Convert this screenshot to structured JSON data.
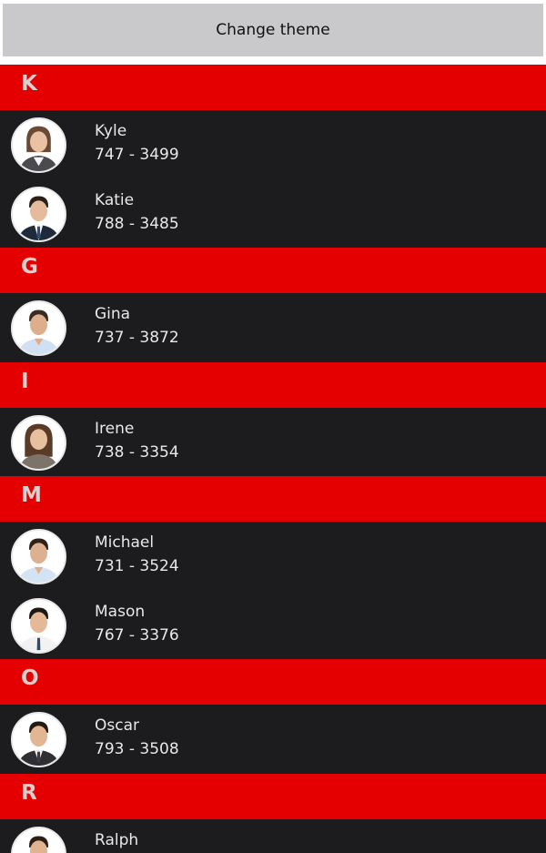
{
  "toolbar": {
    "change_theme_label": "Change theme"
  },
  "groups": [
    {
      "letter": "K",
      "contacts": [
        {
          "name": "Kyle",
          "phone": "747 - 3499",
          "avatar": "woman-portrait-icon"
        },
        {
          "name": "Katie",
          "phone": "788 - 3485",
          "avatar": "man-portrait-icon"
        }
      ]
    },
    {
      "letter": "G",
      "contacts": [
        {
          "name": "Gina",
          "phone": "737 - 3872",
          "avatar": "man-portrait-icon"
        }
      ]
    },
    {
      "letter": "I",
      "contacts": [
        {
          "name": "Irene",
          "phone": "738 - 3354",
          "avatar": "woman-portrait-icon"
        }
      ]
    },
    {
      "letter": "M",
      "contacts": [
        {
          "name": "Michael",
          "phone": "731 - 3524",
          "avatar": "man-portrait-icon"
        },
        {
          "name": "Mason",
          "phone": "767 - 3376",
          "avatar": "man-portrait-icon"
        }
      ]
    },
    {
      "letter": "O",
      "contacts": [
        {
          "name": "Oscar",
          "phone": "793 - 3508",
          "avatar": "man-portrait-icon"
        }
      ]
    },
    {
      "letter": "R",
      "contacts": [
        {
          "name": "Ralph",
          "phone": "",
          "avatar": "man-portrait-icon"
        }
      ]
    }
  ],
  "colors": {
    "header_bg": "#e40000",
    "header_letter": "#d9cfcf",
    "row_bg": "#1c1c1e",
    "row_text": "#e8e8e8",
    "button_bg": "#c9c8ca"
  }
}
